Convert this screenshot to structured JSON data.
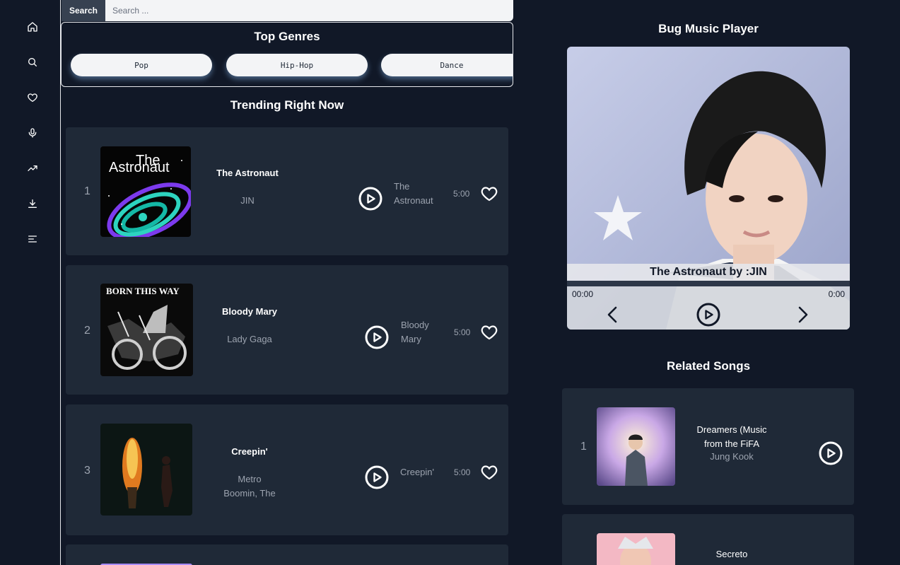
{
  "sidebar": {
    "icons": [
      "home-icon",
      "search-icon",
      "heart-icon",
      "microphone-icon",
      "trending-icon",
      "download-icon",
      "menu-icon"
    ]
  },
  "search": {
    "button_label": "Search",
    "placeholder": "Search ..."
  },
  "genres": {
    "title": "Top Genres",
    "items": [
      "Pop",
      "Hip-Hop",
      "Dance"
    ]
  },
  "trending": {
    "title": "Trending Right Now",
    "tracks": [
      {
        "rank": "1",
        "title": "The Astronaut",
        "artist": "JIN",
        "album_line1": "The",
        "album_line2": "Astronaut",
        "duration": "5:00"
      },
      {
        "rank": "2",
        "title": "Bloody Mary",
        "artist": "Lady Gaga",
        "album_line1": "Bloody",
        "album_line2": "Mary",
        "duration": "5:00"
      },
      {
        "rank": "3",
        "title": "Creepin'",
        "artist_line1": "Metro",
        "artist_line2": "Boomin, The",
        "album_line1": "Creepin'",
        "duration": "5:00"
      }
    ],
    "cover_texts": {
      "astronaut_line1": "The",
      "astronaut_line2": "Astronaut",
      "born": "BORN THIS WAY"
    }
  },
  "player": {
    "title": "Bug Music Player",
    "now_playing": "The Astronaut by :JIN",
    "time_current": "00:00",
    "time_total": "0:00"
  },
  "related": {
    "title": "Related Songs",
    "songs": [
      {
        "rank": "1",
        "title_line1": "Dreamers (Music",
        "title_line2": "from the FiFA",
        "artist": "Jung Kook"
      },
      {
        "title": "Secreto"
      }
    ]
  },
  "colors": {
    "background": "#111827",
    "card": "#1f2937",
    "muted_text": "#9ca3af",
    "pill": "#f3f4f6"
  }
}
